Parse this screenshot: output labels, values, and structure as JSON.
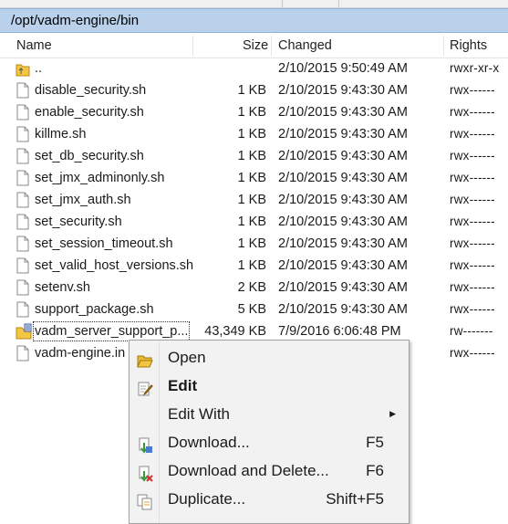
{
  "path": "/opt/vadm-engine/bin",
  "columns": {
    "name": "Name",
    "size": "Size",
    "changed": "Changed",
    "rights": "Rights"
  },
  "files": [
    {
      "name": "..",
      "size": "",
      "changed": "2/10/2015 9:50:49 AM",
      "rights": "rwxr-xr-x",
      "icon": "parent-folder-icon"
    },
    {
      "name": "disable_security.sh",
      "size": "1 KB",
      "changed": "2/10/2015 9:43:30 AM",
      "rights": "rwx------",
      "icon": "file-icon"
    },
    {
      "name": "enable_security.sh",
      "size": "1 KB",
      "changed": "2/10/2015 9:43:30 AM",
      "rights": "rwx------",
      "icon": "file-icon"
    },
    {
      "name": "killme.sh",
      "size": "1 KB",
      "changed": "2/10/2015 9:43:30 AM",
      "rights": "rwx------",
      "icon": "file-icon"
    },
    {
      "name": "set_db_security.sh",
      "size": "1 KB",
      "changed": "2/10/2015 9:43:30 AM",
      "rights": "rwx------",
      "icon": "file-icon"
    },
    {
      "name": "set_jmx_adminonly.sh",
      "size": "1 KB",
      "changed": "2/10/2015 9:43:30 AM",
      "rights": "rwx------",
      "icon": "file-icon"
    },
    {
      "name": "set_jmx_auth.sh",
      "size": "1 KB",
      "changed": "2/10/2015 9:43:30 AM",
      "rights": "rwx------",
      "icon": "file-icon"
    },
    {
      "name": "set_security.sh",
      "size": "1 KB",
      "changed": "2/10/2015 9:43:30 AM",
      "rights": "rwx------",
      "icon": "file-icon"
    },
    {
      "name": "set_session_timeout.sh",
      "size": "1 KB",
      "changed": "2/10/2015 9:43:30 AM",
      "rights": "rwx------",
      "icon": "file-icon"
    },
    {
      "name": "set_valid_host_versions.sh",
      "size": "1 KB",
      "changed": "2/10/2015 9:43:30 AM",
      "rights": "rwx------",
      "icon": "file-icon"
    },
    {
      "name": "setenv.sh",
      "size": "2 KB",
      "changed": "2/10/2015 9:43:30 AM",
      "rights": "rwx------",
      "icon": "file-icon"
    },
    {
      "name": "support_package.sh",
      "size": "5 KB",
      "changed": "2/10/2015 9:43:30 AM",
      "rights": "rwx------",
      "icon": "file-icon"
    },
    {
      "name": "vadm_server_support_p...",
      "size": "43,349 KB",
      "changed": "7/9/2016 6:06:48 PM",
      "rights": "rw-------",
      "icon": "archive-icon",
      "selected": true
    },
    {
      "name": "vadm-engine.in",
      "size": "",
      "changed": "",
      "rights": "rwx------",
      "icon": "file-icon"
    }
  ],
  "context_menu": [
    {
      "label": "Open",
      "shortcut": "",
      "icon": "open-folder-icon"
    },
    {
      "label": "Edit",
      "shortcut": "",
      "icon": "edit-icon",
      "bold": true
    },
    {
      "label": "Edit With",
      "shortcut": "",
      "icon": "",
      "submenu": true
    },
    {
      "label": "Download...",
      "shortcut": "F5",
      "icon": "download-icon"
    },
    {
      "label": "Download and Delete...",
      "shortcut": "F6",
      "icon": "download-delete-icon"
    },
    {
      "label": "Duplicate...",
      "shortcut": "Shift+F5",
      "icon": "duplicate-icon"
    }
  ],
  "colors": {
    "path_bar": "#b9d1ea",
    "menu_bg": "#f2f2f2",
    "folder": "#f4c542",
    "download_green": "#3a9a3a"
  }
}
